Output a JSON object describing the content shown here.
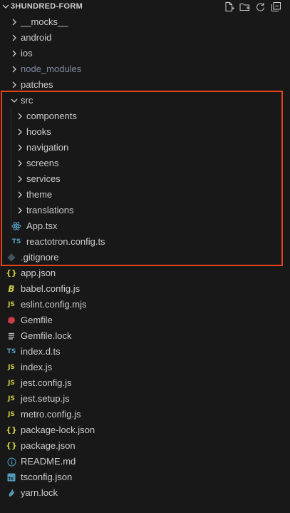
{
  "explorer": {
    "title": "3HUNDRED-FORM",
    "actions": [
      "new-file-icon",
      "new-folder-icon",
      "refresh-icon",
      "collapse-all-icon"
    ]
  },
  "tree": [
    {
      "label": "__mocks__",
      "type": "folder",
      "expanded": false
    },
    {
      "label": "android",
      "type": "folder",
      "expanded": false
    },
    {
      "label": "ios",
      "type": "folder",
      "expanded": false
    },
    {
      "label": "node_modules",
      "type": "folder",
      "expanded": false,
      "dimmed": true
    },
    {
      "label": "patches",
      "type": "folder",
      "expanded": false
    },
    {
      "label": "src",
      "type": "folder",
      "expanded": true
    },
    {
      "label": "components",
      "type": "folder",
      "expanded": false
    },
    {
      "label": "hooks",
      "type": "folder",
      "expanded": false
    },
    {
      "label": "navigation",
      "type": "folder",
      "expanded": false
    },
    {
      "label": "screens",
      "type": "folder",
      "expanded": false
    },
    {
      "label": "services",
      "type": "folder",
      "expanded": false
    },
    {
      "label": "theme",
      "type": "folder",
      "expanded": false
    },
    {
      "label": "translations",
      "type": "folder",
      "expanded": false
    },
    {
      "label": "App.tsx",
      "type": "file",
      "icon": "react-icon"
    },
    {
      "label": "reactotron.config.ts",
      "type": "file",
      "icon": "typescript-icon"
    },
    {
      "label": ".gitignore",
      "type": "file",
      "icon": "git-icon"
    },
    {
      "label": "app.json",
      "type": "file",
      "icon": "json-icon"
    },
    {
      "label": "babel.config.js",
      "type": "file",
      "icon": "babel-icon"
    },
    {
      "label": "eslint.config.mjs",
      "type": "file",
      "icon": "javascript-icon"
    },
    {
      "label": "Gemfile",
      "type": "file",
      "icon": "ruby-icon"
    },
    {
      "label": "Gemfile.lock",
      "type": "file",
      "icon": "lock-lines-icon"
    },
    {
      "label": "index.d.ts",
      "type": "file",
      "icon": "typescript-icon"
    },
    {
      "label": "index.js",
      "type": "file",
      "icon": "javascript-icon"
    },
    {
      "label": "jest.config.js",
      "type": "file",
      "icon": "javascript-icon"
    },
    {
      "label": "jest.setup.js",
      "type": "file",
      "icon": "javascript-icon"
    },
    {
      "label": "metro.config.js",
      "type": "file",
      "icon": "javascript-icon"
    },
    {
      "label": "package-lock.json",
      "type": "file",
      "icon": "json-icon"
    },
    {
      "label": "package.json",
      "type": "file",
      "icon": "json-icon"
    },
    {
      "label": "README.md",
      "type": "file",
      "icon": "info-icon"
    },
    {
      "label": "tsconfig.json",
      "type": "file",
      "icon": "tsconfig-icon"
    },
    {
      "label": "yarn.lock",
      "type": "file",
      "icon": "yarn-icon"
    }
  ],
  "colors": {
    "background": "#181818",
    "text": "#cccccc",
    "highlight_border": "#e3421b",
    "js": "#cbcb41",
    "json": "#cbcb41",
    "ts": "#519aba",
    "react": "#519aba",
    "git": "#41535b",
    "ruby": "#cc3e44"
  }
}
